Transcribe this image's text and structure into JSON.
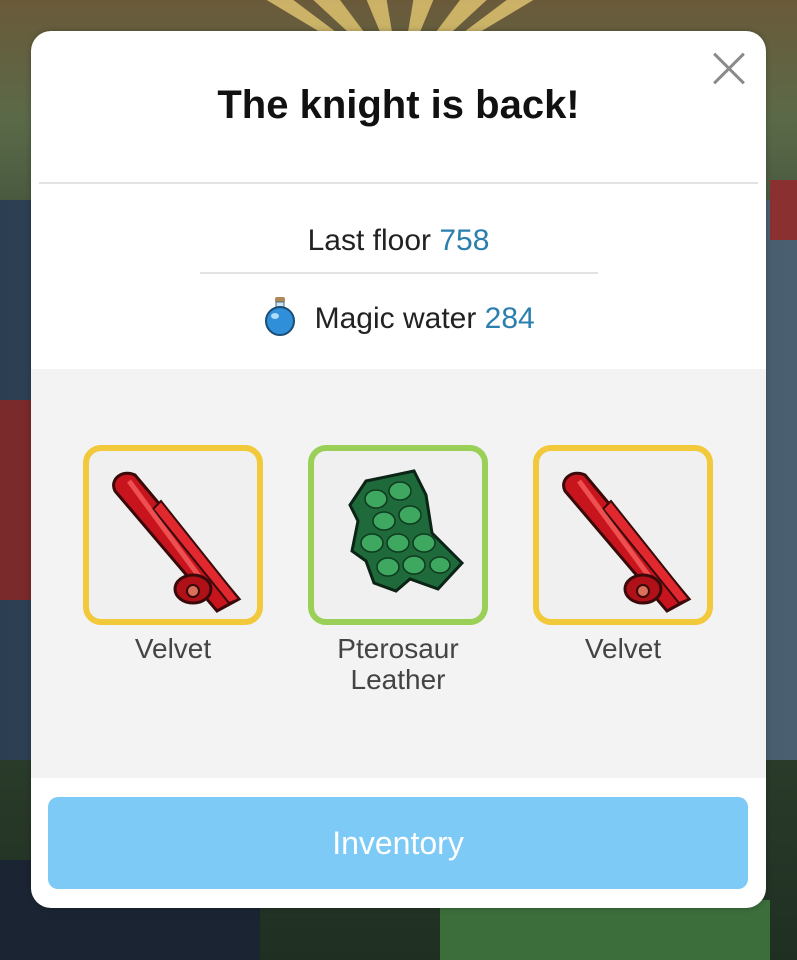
{
  "dialog": {
    "title": "The knight is back!",
    "close_icon": "close-icon"
  },
  "stats": {
    "last_floor_label": "Last floor",
    "last_floor_value": "758",
    "magic_water_label": "Magic water",
    "magic_water_value": "284",
    "magic_water_icon": "potion-icon"
  },
  "rewards": [
    {
      "name": "Velvet",
      "icon": "velvet-roll-icon",
      "rarity_color": "#f1c93a"
    },
    {
      "name_line1": "Pterosaur",
      "name_line2": "Leather",
      "icon": "leather-icon",
      "rarity_color": "#9bd058"
    },
    {
      "name": "Velvet",
      "icon": "velvet-roll-icon",
      "rarity_color": "#f1c93a"
    }
  ],
  "button": {
    "label": "Inventory",
    "color": "#7ecaf6"
  },
  "colors": {
    "value_accent": "#2a7fae"
  }
}
